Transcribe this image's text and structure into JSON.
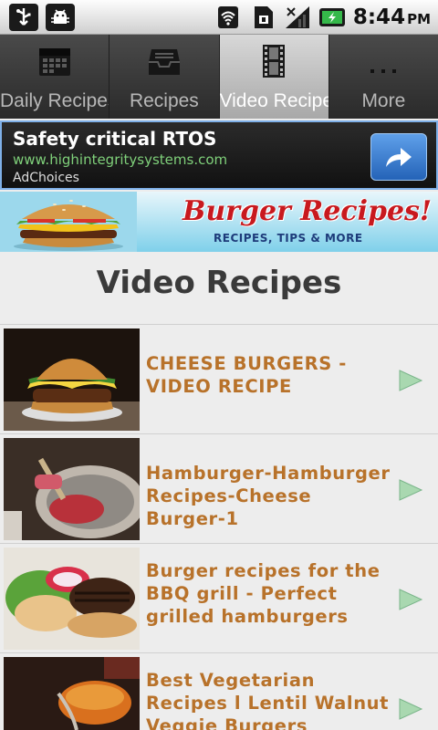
{
  "status_bar": {
    "left_icons": [
      "usb-icon",
      "android-debug-icon"
    ],
    "right_icons": [
      "wifi-icon",
      "sim-icon",
      "signal-icon",
      "battery-charging-icon"
    ],
    "time": "8:44",
    "ampm": "PM"
  },
  "tabs": [
    {
      "label": "Daily Recipes",
      "icon": "calendar-icon",
      "active": false
    },
    {
      "label": "Recipes",
      "icon": "inbox-icon",
      "active": false
    },
    {
      "label": "Video Recipes",
      "icon": "film-icon",
      "active": true
    },
    {
      "label": "More",
      "icon": "more-dots-icon",
      "active": false
    }
  ],
  "ad": {
    "title": "Safety critical RTOS",
    "url": "www.highintegritysystems.com",
    "choices": "AdChoices",
    "button_icon": "share-arrow-icon"
  },
  "banner": {
    "title": "Burger Recipes!",
    "subtitle": "RECIPES, TIPS & MORE"
  },
  "page": {
    "title": "Video Recipes"
  },
  "videos": [
    {
      "title": "CHEESE BURGERS - VIDEO RECIPE"
    },
    {
      "title": "Hamburger-Hamburger Recipes-Cheese Burger-1"
    },
    {
      "title": "Burger recipes for the BBQ grill - Perfect grilled hamburgers"
    },
    {
      "title": "Best Vegetarian Recipes l Lentil Walnut Veggie Burgers"
    }
  ],
  "colors": {
    "accent_title": "#b8722a",
    "ad_url": "#7fd07a",
    "active_tab": "#bdbdbd"
  }
}
